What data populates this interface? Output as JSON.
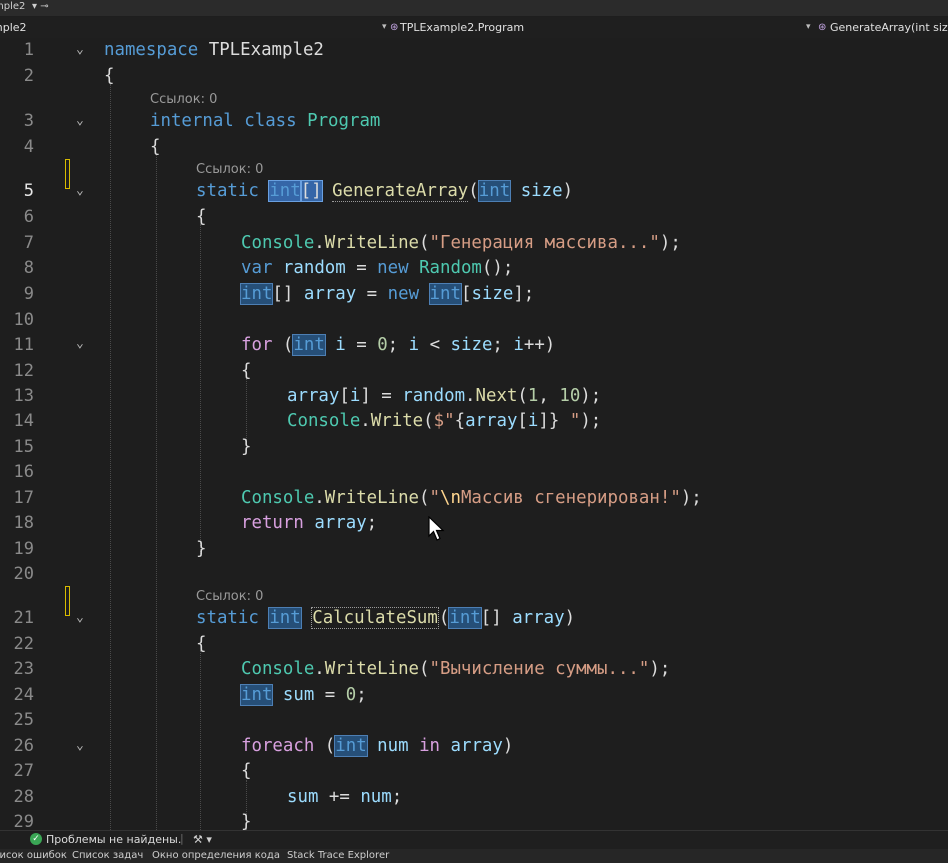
{
  "top_tab": {
    "label": "mple2",
    "pin": "▾ ⊸"
  },
  "nav": {
    "project": "mple2",
    "class_path": "TPLExample2.Program",
    "member": "GenerateArray(int size)"
  },
  "gutter": {
    "line_numbers": [
      "1",
      "2",
      "3",
      "4",
      "5",
      "6",
      "7",
      "8",
      "9",
      "10",
      "11",
      "12",
      "13",
      "14",
      "15",
      "16",
      "17",
      "18",
      "19",
      "20",
      "21",
      "22",
      "23",
      "24",
      "25",
      "26",
      "27",
      "28",
      "29"
    ],
    "current_line": "5"
  },
  "codelens": {
    "program": "Ссылок: 0",
    "generate_array": "Ссылок: 0",
    "calculate_sum": "Ссылок: 0"
  },
  "code": {
    "l1": {
      "kw": "namespace",
      "name": "TPLExample2"
    },
    "l2": "{",
    "l3": {
      "kw1": "internal",
      "kw2": "class",
      "name": "Program"
    },
    "l4": "{",
    "l5": {
      "kw": "static",
      "ret": "int",
      "ret_br": "[]",
      "fn": "GenerateArray",
      "p_type": "int",
      "p_name": "size"
    },
    "l6": "{",
    "l7": {
      "cls": "Console",
      "fn": "WriteLine",
      "str": "\"Генерация массива...\""
    },
    "l8": {
      "kw": "var",
      "var": "random",
      "kw_new": "new",
      "cls": "Random"
    },
    "l9": {
      "type": "int",
      "var": "array",
      "kw_new": "new",
      "type2": "int",
      "arg": "size"
    },
    "l11": {
      "kw": "for",
      "type": "int",
      "i": "i",
      "zero": "0",
      "size": "size"
    },
    "l12": "{",
    "l13": {
      "arr": "array",
      "i": "i",
      "random": "random",
      "fn": "Next",
      "a": "1",
      "b": "10"
    },
    "l14": {
      "cls": "Console",
      "fn": "Write",
      "s1": "$\"",
      "open": "{",
      "arr": "array",
      "i": "i",
      "close": "}",
      "s2": " \""
    },
    "l15": "}",
    "l17": {
      "cls": "Console",
      "fn": "WriteLine",
      "s1": "\"",
      "esc": "\\n",
      "s2": "Массив сгенерирован!\""
    },
    "l18": {
      "kw": "return",
      "var": "array"
    },
    "l19": "}",
    "l21": {
      "kw": "static",
      "ret": "int",
      "fn": "CalculateSum",
      "p_type": "int",
      "p_br": "[]",
      "p_name": "array"
    },
    "l22": "{",
    "l23": {
      "cls": "Console",
      "fn": "WriteLine",
      "str": "\"Вычисление суммы...\""
    },
    "l24": {
      "type": "int",
      "var": "sum",
      "zero": "0"
    },
    "l26": {
      "kw": "foreach",
      "type": "int",
      "var": "num",
      "kw_in": "in",
      "arr": "array"
    },
    "l27": "{",
    "l28": {
      "sum": "sum",
      "num": "num"
    },
    "l29": "}"
  },
  "status": {
    "ok_text": "Проблемы не найдены.",
    "brush": "⚒ ▾"
  },
  "bottom_tabs": [
    "Список ошибок",
    "Список задач",
    "Окно определения кода",
    "Stack Trace Explorer"
  ],
  "colors": {
    "keyword": "#569cd6",
    "type": "#4ec9b0",
    "method": "#dcdcaa",
    "string": "#d69d85",
    "identifier": "#9cdcfe",
    "number": "#b5cea8",
    "highlight": "#264f78"
  }
}
